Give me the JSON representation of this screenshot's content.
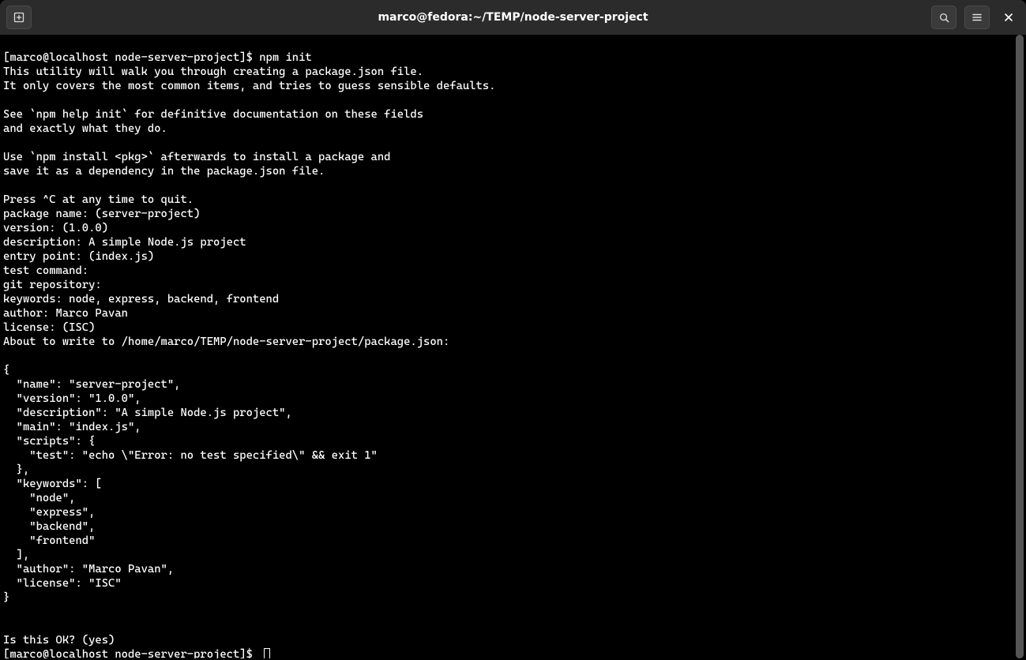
{
  "title": "marco@fedora:~/TEMP/node-server-project",
  "terminal": {
    "prompt1": "[marco@localhost node-server-project]$ npm init",
    "line2": "This utility will walk you through creating a package.json file.",
    "line3": "It only covers the most common items, and tries to guess sensible defaults.",
    "blank1": "",
    "line4": "See `npm help init` for definitive documentation on these fields",
    "line5": "and exactly what they do.",
    "blank2": "",
    "line6": "Use `npm install <pkg>` afterwards to install a package and",
    "line7": "save it as a dependency in the package.json file.",
    "blank3": "",
    "line8": "Press ^C at any time to quit.",
    "line9": "package name: (server-project) ",
    "line10": "version: (1.0.0) ",
    "line11": "description: A simple Node.js project",
    "line12": "entry point: (index.js) ",
    "line13": "test command: ",
    "line14": "git repository: ",
    "line15": "keywords: node, express, backend, frontend",
    "line16": "author: Marco Pavan",
    "line17": "license: (ISC) ",
    "line18": "About to write to /home/marco/TEMP/node-server-project/package.json:",
    "blank4": "",
    "j1": "{",
    "j2": "  \"name\": \"server-project\",",
    "j3": "  \"version\": \"1.0.0\",",
    "j4": "  \"description\": \"A simple Node.js project\",",
    "j5": "  \"main\": \"index.js\",",
    "j6": "  \"scripts\": {",
    "j7": "    \"test\": \"echo \\\"Error: no test specified\\\" && exit 1\"",
    "j8": "  },",
    "j9": "  \"keywords\": [",
    "j10": "    \"node\",",
    "j11": "    \"express\",",
    "j12": "    \"backend\",",
    "j13": "    \"frontend\"",
    "j14": "  ],",
    "j15": "  \"author\": \"Marco Pavan\",",
    "j16": "  \"license\": \"ISC\"",
    "j17": "}",
    "blank5": "",
    "blank6": "",
    "line19": "Is this OK? (yes) ",
    "prompt2": "[marco@localhost node-server-project]$ "
  }
}
